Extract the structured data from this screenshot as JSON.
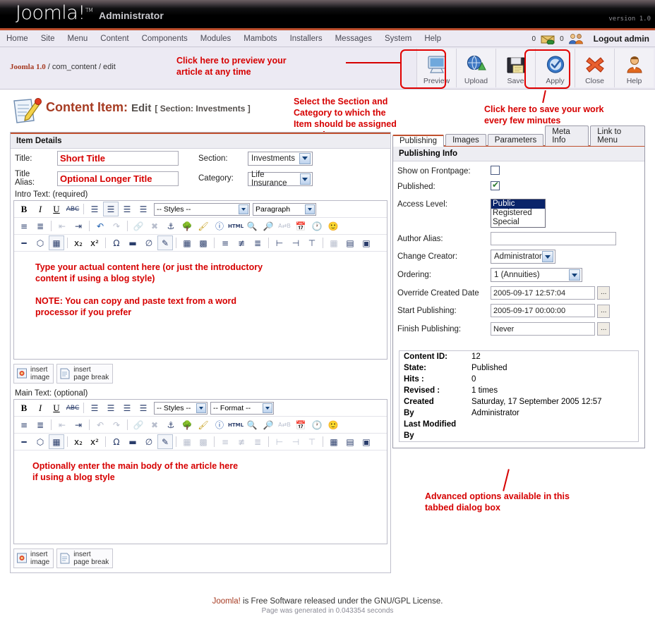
{
  "header": {
    "logo": "Joomla!",
    "logo_tm": "TM",
    "admin_word": "Administrator",
    "version": "version 1.0"
  },
  "menubar": {
    "items": [
      {
        "label": "Home"
      },
      {
        "label": "Site"
      },
      {
        "label": "Menu"
      },
      {
        "label": "Content"
      },
      {
        "label": "Components"
      },
      {
        "label": "Modules"
      },
      {
        "label": "Mambots"
      },
      {
        "label": "Installers"
      },
      {
        "label": "Messages"
      },
      {
        "label": "System"
      },
      {
        "label": "Help"
      }
    ],
    "mail_count": "0",
    "user_count": "0",
    "logout": "Logout admin"
  },
  "path": {
    "app": "Joomla 1.0",
    "rest": " / com_content / edit"
  },
  "toolbar": {
    "buttons": [
      {
        "label": "Preview",
        "icon": "monitor-preview-icon",
        "highlight": true
      },
      {
        "label": "Upload",
        "icon": "globe-upload-icon",
        "highlight": false
      },
      {
        "label": "Save",
        "icon": "floppy-save-icon",
        "highlight": false
      },
      {
        "label": "Apply",
        "icon": "check-circle-apply-icon",
        "highlight": true
      },
      {
        "label": "Close",
        "icon": "red-x-close-icon",
        "highlight": false
      },
      {
        "label": "Help",
        "icon": "person-help-icon",
        "highlight": false
      }
    ]
  },
  "page_title": {
    "main": "Content Item:",
    "sub": "Edit",
    "section": "[ Section: Investments ]"
  },
  "annotations": [
    {
      "id": "preview-note",
      "text": "Click here to preview your\narticle at any time"
    },
    {
      "id": "section-note",
      "text": "Select the Section and\nCategory to which the\nItem should be assigned"
    },
    {
      "id": "apply-note",
      "text": "Click here to save your work\nevery few minutes"
    },
    {
      "id": "intro-note",
      "text": "Type your actual content here (or just the introductory\ncontent if using a blog style)"
    },
    {
      "id": "paste-note",
      "text": "NOTE: You can copy and paste text from a word\nprocessor if you prefer"
    },
    {
      "id": "maintext-note",
      "text": "Optionally enter the main body of the article here\nif using a blog style"
    },
    {
      "id": "tabs-note",
      "text": "Advanced options available in this\ntabbed dialog box"
    }
  ],
  "item_details": {
    "panel_title": "Item Details",
    "title_label": "Title:",
    "title_value": "Short Title",
    "alias_label": "Title Alias:",
    "alias_value": "Optional Longer Title",
    "section_label": "Section:",
    "section_value": "Investments",
    "category_label": "Category:",
    "category_value": "Life Insurance",
    "intro_label": "Intro Text: (required)",
    "maintext_label": "Main Text: (optional)"
  },
  "editor": {
    "styles_placeholder": "-- Styles --",
    "paragraph_value": "Paragraph",
    "format_placeholder": "-- Format --",
    "row1_icons": [
      "bold-icon",
      "italic-icon",
      "underline-icon",
      "strikethrough-icon",
      "align-left-icon",
      "align-center-icon",
      "align-right-icon",
      "align-justify-icon"
    ],
    "row2_icons": [
      "unordered-list-icon",
      "ordered-list-icon",
      "outdent-icon",
      "indent-icon",
      "undo-icon",
      "redo-icon",
      "link-icon",
      "unlink-icon",
      "anchor-icon",
      "image-icon",
      "cleanup-icon",
      "help-icon",
      "html-icon",
      "preview-icon",
      "search-icon",
      "replace-icon",
      "insert-date-icon",
      "insert-time-icon",
      "emoticon-icon"
    ],
    "row3_icons": [
      "horizontal-rule-icon",
      "remove-format-icon",
      "toggle-borders-icon",
      "subscript-icon",
      "superscript-icon",
      "special-char-icon",
      "nonbreaking-icon",
      "visual-aid-icon",
      "edit-css-icon",
      "insert-table-icon",
      "table-props-icon",
      "row-props-icon",
      "cell-props-icon",
      "insert-row-before-icon",
      "insert-row-after-icon",
      "delete-row-icon",
      "insert-col-before-icon",
      "insert-col-after-icon",
      "delete-col-icon",
      "split-cell-icon",
      "merge-cell-icon",
      "fullscreen-icon"
    ]
  },
  "insert_buttons": [
    {
      "label_line1": "insert",
      "label_line2": "image",
      "icon": "insert-image-icon"
    },
    {
      "label_line1": "insert",
      "label_line2": "page break",
      "icon": "insert-page-break-icon"
    }
  ],
  "tabs": [
    {
      "label": "Publishing",
      "active": true
    },
    {
      "label": "Images",
      "active": false
    },
    {
      "label": "Parameters",
      "active": false
    },
    {
      "label": "Meta Info",
      "active": false
    },
    {
      "label": "Link to Menu",
      "active": false
    }
  ],
  "publishing": {
    "heading": "Publishing Info",
    "show_on_frontpage_label": "Show on Frontpage:",
    "show_on_frontpage_checked": false,
    "published_label": "Published:",
    "published_checked": true,
    "access_level_label": "Access Level:",
    "access_level_options": [
      "Public",
      "Registered",
      "Special"
    ],
    "access_level_selected": "Public",
    "author_alias_label": "Author Alias:",
    "author_alias_value": "",
    "change_creator_label": "Change Creator:",
    "change_creator_value": "Administrator",
    "ordering_label": "Ordering:",
    "ordering_value": "1 (Annuities)",
    "override_created_label": "Override Created Date",
    "override_created_value": "2005-09-17 12:57:04",
    "start_publishing_label": "Start Publishing:",
    "start_publishing_value": "2005-09-17 00:00:00",
    "finish_publishing_label": "Finish Publishing:",
    "finish_publishing_value": "Never",
    "calendar_button": "..."
  },
  "content_info": {
    "rows": [
      {
        "key": "Content ID:",
        "value": "12"
      },
      {
        "key": "State:",
        "value": "Published"
      },
      {
        "key": "Hits :",
        "value": "0"
      },
      {
        "key": "Revised :",
        "value": "1 times"
      },
      {
        "key": "Created",
        "value": "Saturday, 17 September 2005 12:57"
      },
      {
        "key": "By",
        "value": "Administrator"
      },
      {
        "key": "Last Modified",
        "value": ""
      },
      {
        "key": "By",
        "value": ""
      }
    ]
  },
  "footer": {
    "brand": "Joomla!",
    "license": " is Free Software released under the GNU/GPL License.",
    "generated": "Page was generated in 0.043354 seconds"
  },
  "colors": {
    "accent": "#c0502e",
    "annotation": "#d60000",
    "title": "#a63b22",
    "menu_bg": "#eceaf3"
  }
}
